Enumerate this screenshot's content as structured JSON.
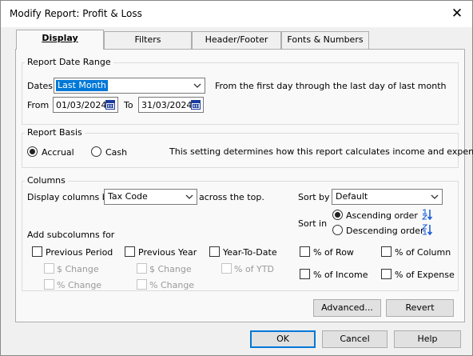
{
  "window": {
    "title": "Modify Report: Profit & Loss",
    "close_glyph": "✕"
  },
  "tabs": [
    {
      "label": "Display",
      "active": true
    },
    {
      "label": "Filters",
      "active": false
    },
    {
      "label": "Header/Footer",
      "active": false
    },
    {
      "label": "Fonts & Numbers",
      "active": false
    }
  ],
  "date_range": {
    "group_label": "Report Date Range",
    "dates_label": "Dates",
    "dates_value": "Last Month",
    "description": "From the first day through the last day of last month",
    "from_label": "From",
    "from_value": "01/03/2024",
    "to_label": "To",
    "to_value": "31/03/2024"
  },
  "basis": {
    "group_label": "Report Basis",
    "accrual_label": "Accrual",
    "cash_label": "Cash",
    "selected": "Accrual",
    "description": "This setting determines how this report calculates income and expenses."
  },
  "columns": {
    "group_label": "Columns",
    "display_label": "Display columns by",
    "display_value": "Tax Code",
    "across_label": "across the top.",
    "sort_by_label": "Sort by",
    "sort_by_value": "Default",
    "sort_in_label": "Sort in",
    "ascending_label": "Ascending order",
    "descending_label": "Descending order",
    "sort_selected": "Ascending order",
    "subcolumns_label": "Add subcolumns for",
    "previous_period": "Previous Period",
    "previous_year": "Previous Year",
    "year_to_date": "Year-To-Date",
    "pp_change": "$ Change",
    "pp_pct_change": "% Change",
    "py_change": "$ Change",
    "py_pct_change": "% Change",
    "ytd_pct": "% of YTD",
    "pct_row": "% of Row",
    "pct_column": "% of Column",
    "pct_income": "% of Income",
    "pct_expense": "% of Expense"
  },
  "panel_buttons": {
    "advanced": "Advanced...",
    "revert": "Revert"
  },
  "dialog_buttons": {
    "ok": "OK",
    "cancel": "Cancel",
    "help": "Help"
  },
  "colors": {
    "selection": "#0078d7",
    "sort_icon_blue": "#1f5fd6"
  }
}
